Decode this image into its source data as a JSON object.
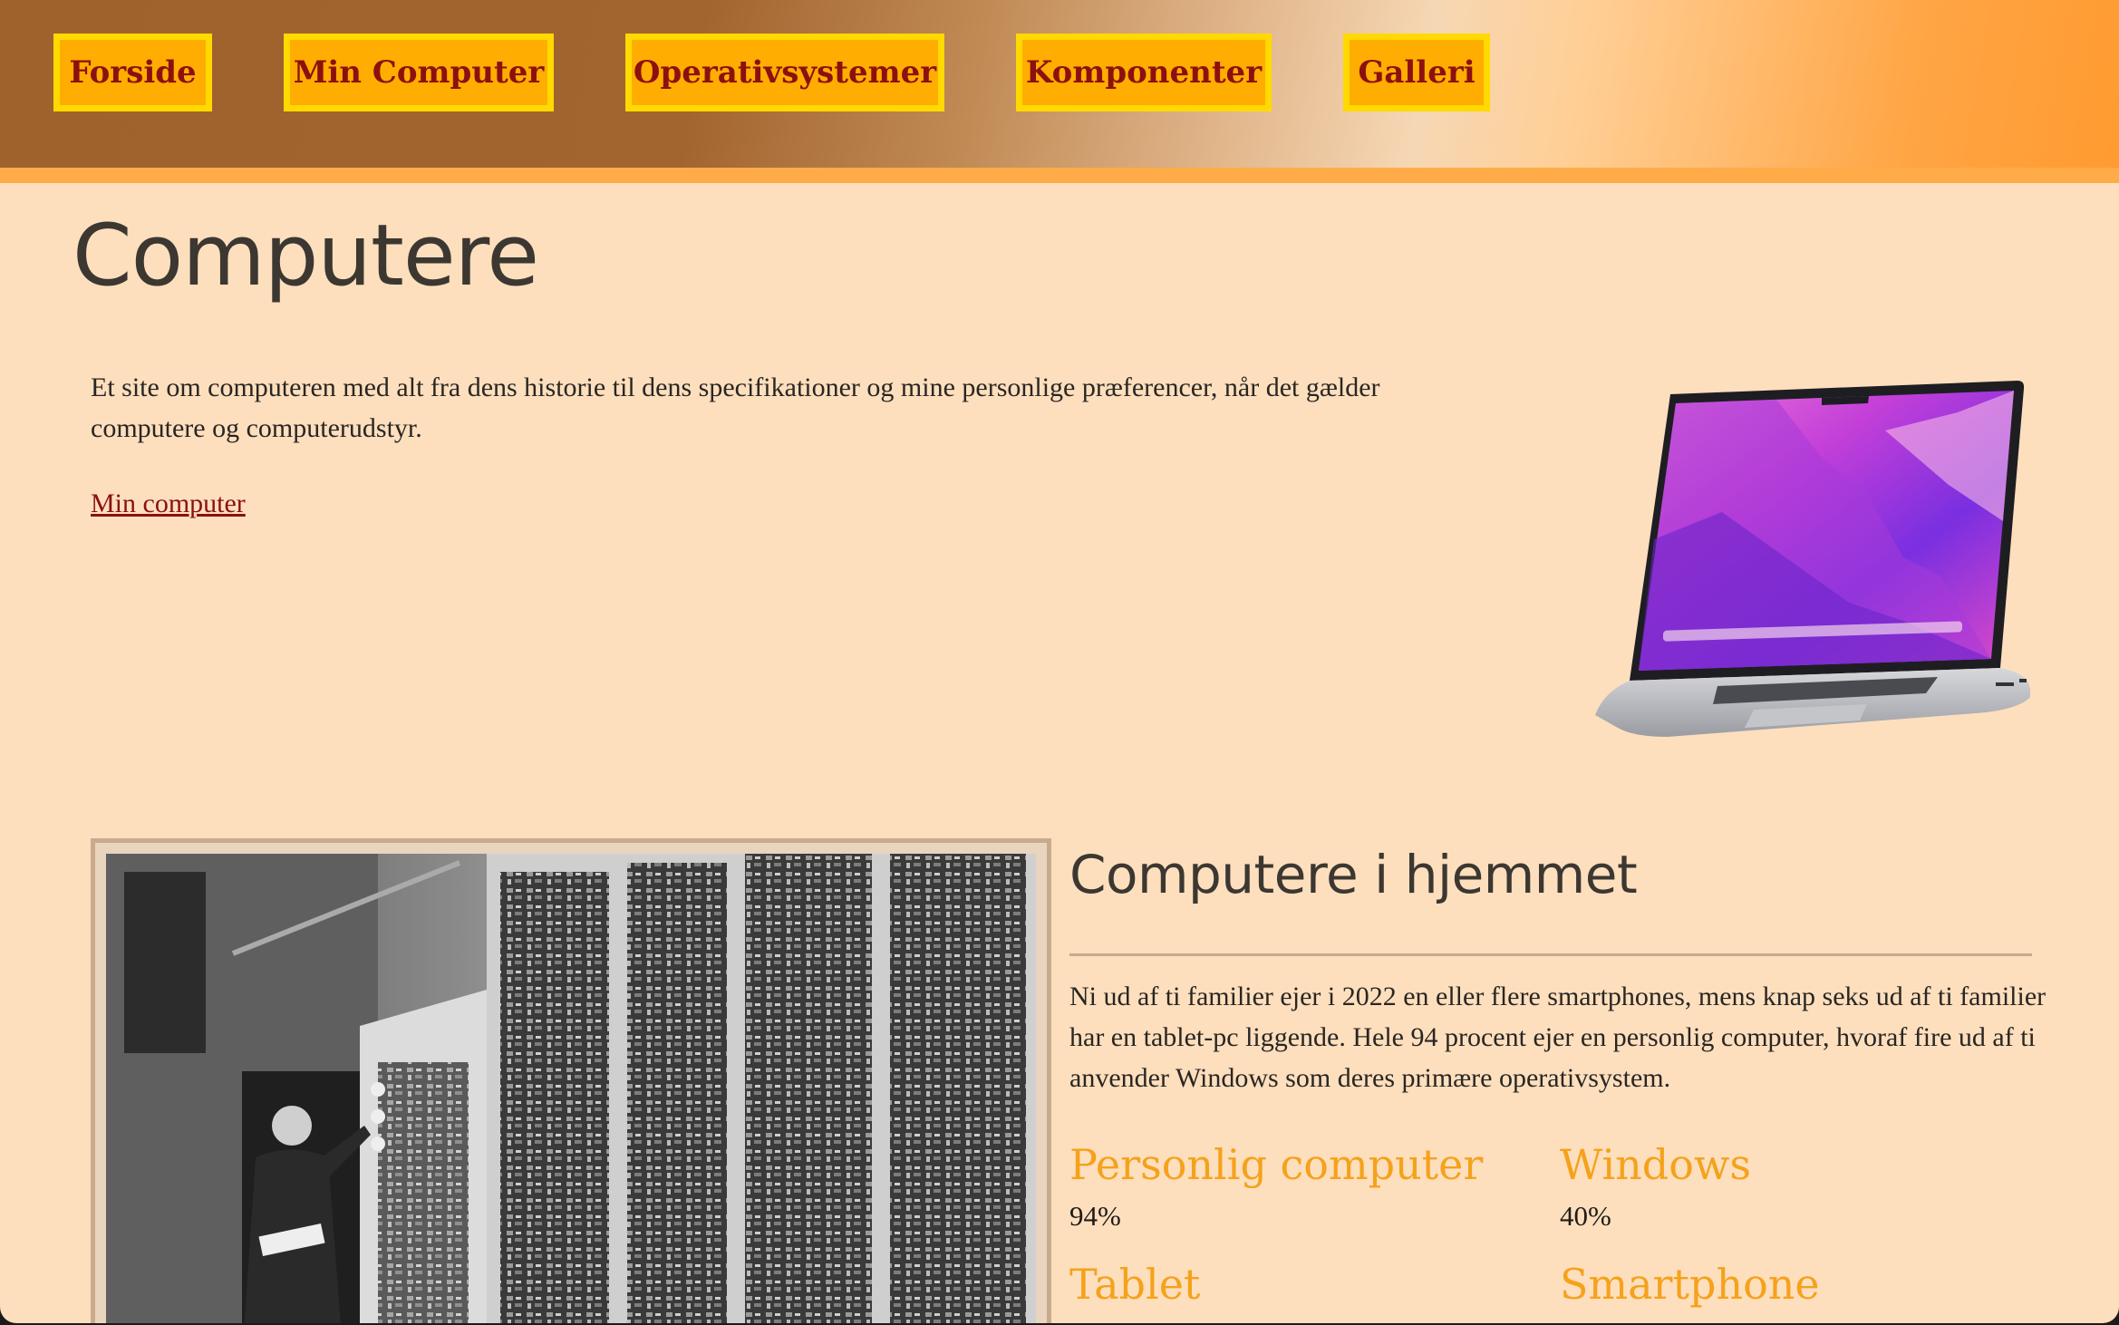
{
  "nav": {
    "items": [
      {
        "label": "Forside"
      },
      {
        "label": "Min Computer"
      },
      {
        "label": "Operativsystemer"
      },
      {
        "label": "Komponenter"
      },
      {
        "label": "Galleri"
      }
    ]
  },
  "hero": {
    "title": "Computere",
    "intro": "Et site om computeren med alt fra dens historie til dens specifikationer og mine personlige præferencer, når det gælder computere og computerudstyr.",
    "link": "Min computer"
  },
  "section": {
    "title": "Computere i hjemmet",
    "text": "Ni ud af ti familier ejer i 2022 en eller flere smartphones, mens knap seks ud af ti familier har en tablet-pc liggende. Hele 94 procent ejer en personlig computer, hvoraf fire ud af ti anvender Windows som deres primære operativsystem.",
    "stats": [
      {
        "label": "Personlig computer",
        "value": "94%"
      },
      {
        "label": "Windows",
        "value": "40%"
      },
      {
        "label": "Tablet",
        "value": ""
      },
      {
        "label": "Smartphone",
        "value": ""
      }
    ]
  },
  "colors": {
    "page_bg": "#fddfbe",
    "nav_button_bg": "#ffad00",
    "nav_button_border": "#ffd900",
    "nav_text": "#8c1010",
    "stat_label": "#f5a21b",
    "heading": "#3c3731"
  }
}
